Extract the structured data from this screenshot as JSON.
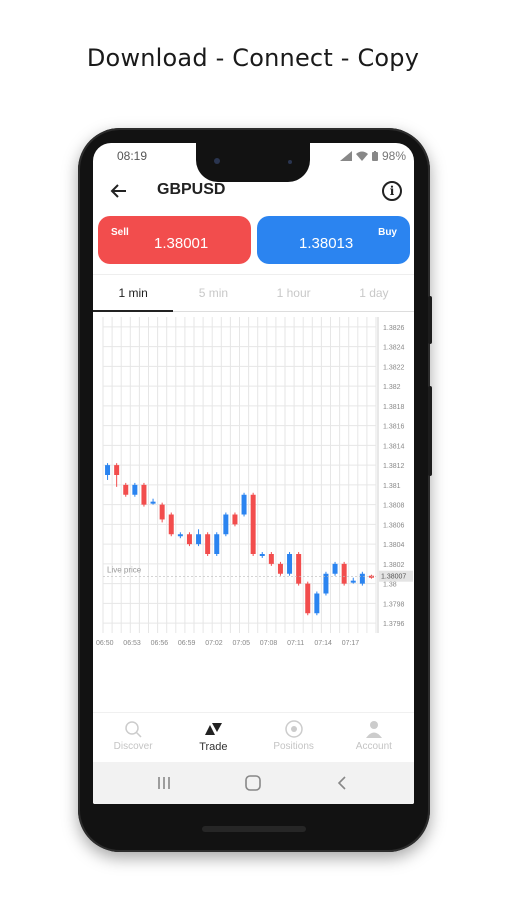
{
  "headline": "Download - Connect - Copy",
  "status": {
    "time": "08:19",
    "battery": "98%"
  },
  "appbar": {
    "title": "GBPUSD",
    "back_icon": "arrow-left-icon",
    "info_icon": "info-icon"
  },
  "sell": {
    "label": "Sell",
    "price": "1.38001",
    "color": "#f24d4d"
  },
  "buy": {
    "label": "Buy",
    "price": "1.38013",
    "color": "#2b84f0"
  },
  "tabs": [
    {
      "label": "1 min",
      "active": true
    },
    {
      "label": "5 min",
      "active": false
    },
    {
      "label": "1 hour",
      "active": false
    },
    {
      "label": "1 day",
      "active": false
    }
  ],
  "chart_data": {
    "type": "candlestick",
    "y_ticks": [
      "1.3826",
      "1.3824",
      "1.3822",
      "1.382",
      "1.3818",
      "1.3816",
      "1.3814",
      "1.3812",
      "1.381",
      "1.3808",
      "1.3806",
      "1.3804",
      "1.3802",
      "1.38",
      "1.3798",
      "1.3796"
    ],
    "x_ticks": [
      "06:50",
      "06:53",
      "06:56",
      "06:59",
      "07:02",
      "07:05",
      "07:08",
      "07:11",
      "07:14",
      "07:17"
    ],
    "ylim": [
      1.3795,
      1.3827
    ],
    "live_price_label": "Live price",
    "live_price": "1.38007",
    "up_color": "#2b84f0",
    "down_color": "#f24d4d",
    "candles": [
      {
        "open": 1.3811,
        "close": 1.3812,
        "high": 1.38122,
        "low": 1.38105
      },
      {
        "open": 1.3812,
        "close": 1.3811,
        "high": 1.38122,
        "low": 1.38098
      },
      {
        "open": 1.381,
        "close": 1.3809,
        "high": 1.38102,
        "low": 1.38088
      },
      {
        "open": 1.3809,
        "close": 1.381,
        "high": 1.38102,
        "low": 1.38088
      },
      {
        "open": 1.381,
        "close": 1.3808,
        "high": 1.38102,
        "low": 1.38078
      },
      {
        "open": 1.38083,
        "close": 1.38083,
        "high": 1.38086,
        "low": 1.3808
      },
      {
        "open": 1.3808,
        "close": 1.38065,
        "high": 1.38082,
        "low": 1.38062
      },
      {
        "open": 1.3807,
        "close": 1.3805,
        "high": 1.38072,
        "low": 1.38048
      },
      {
        "open": 1.3805,
        "close": 1.3805,
        "high": 1.38052,
        "low": 1.38046
      },
      {
        "open": 1.3805,
        "close": 1.3804,
        "high": 1.38052,
        "low": 1.38038
      },
      {
        "open": 1.3804,
        "close": 1.3805,
        "high": 1.38055,
        "low": 1.38038
      },
      {
        "open": 1.3805,
        "close": 1.3803,
        "high": 1.38052,
        "low": 1.38028
      },
      {
        "open": 1.3803,
        "close": 1.3805,
        "high": 1.38052,
        "low": 1.38028
      },
      {
        "open": 1.3805,
        "close": 1.3807,
        "high": 1.38072,
        "low": 1.38048
      },
      {
        "open": 1.3807,
        "close": 1.3806,
        "high": 1.38072,
        "low": 1.38058
      },
      {
        "open": 1.3807,
        "close": 1.3809,
        "high": 1.38092,
        "low": 1.38068
      },
      {
        "open": 1.3809,
        "close": 1.3803,
        "high": 1.38092,
        "low": 1.38028
      },
      {
        "open": 1.3803,
        "close": 1.3803,
        "high": 1.38032,
        "low": 1.38026
      },
      {
        "open": 1.3803,
        "close": 1.3802,
        "high": 1.38032,
        "low": 1.38018
      },
      {
        "open": 1.3802,
        "close": 1.3801,
        "high": 1.38022,
        "low": 1.38008
      },
      {
        "open": 1.3801,
        "close": 1.3803,
        "high": 1.38032,
        "low": 1.38008
      },
      {
        "open": 1.3803,
        "close": 1.38,
        "high": 1.38032,
        "low": 1.37998
      },
      {
        "open": 1.38,
        "close": 1.3797,
        "high": 1.38002,
        "low": 1.37968
      },
      {
        "open": 1.3797,
        "close": 1.3799,
        "high": 1.37992,
        "low": 1.37968
      },
      {
        "open": 1.3799,
        "close": 1.3801,
        "high": 1.38012,
        "low": 1.37988
      },
      {
        "open": 1.3801,
        "close": 1.3802,
        "high": 1.38022,
        "low": 1.38008
      },
      {
        "open": 1.3802,
        "close": 1.38,
        "high": 1.38022,
        "low": 1.37998
      },
      {
        "open": 1.38003,
        "close": 1.38003,
        "high": 1.38006,
        "low": 1.38
      },
      {
        "open": 1.38,
        "close": 1.3801,
        "high": 1.38012,
        "low": 1.37998
      },
      {
        "open": 1.38008,
        "close": 1.38006,
        "high": 1.38009,
        "low": 1.38005
      }
    ]
  },
  "nav": [
    {
      "label": "Discover",
      "icon": "search-icon",
      "active": false
    },
    {
      "label": "Trade",
      "icon": "trade-icon",
      "active": true
    },
    {
      "label": "Positions",
      "icon": "positions-icon",
      "active": false
    },
    {
      "label": "Account",
      "icon": "person-icon",
      "active": false
    }
  ],
  "sysbar": {
    "recents_icon": "recents-icon",
    "home_icon": "home-icon",
    "back_icon": "back-chevron-icon"
  }
}
